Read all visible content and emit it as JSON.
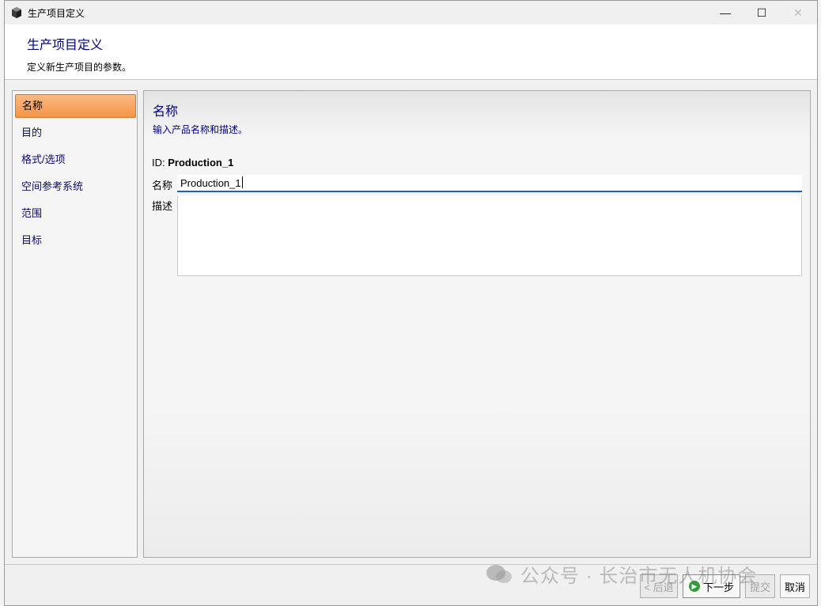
{
  "window": {
    "title": "生产项目定义",
    "controls": {
      "minimize": "—",
      "maximize": "☐",
      "close": "✕"
    }
  },
  "header": {
    "title": "生产项目定义",
    "subtitle": "定义新生产项目的参数。"
  },
  "nav": {
    "items": [
      {
        "label": "名称",
        "active": true
      },
      {
        "label": "目的",
        "active": false
      },
      {
        "label": "格式/选项",
        "active": false
      },
      {
        "label": "空间参考系统",
        "active": false
      },
      {
        "label": "范围",
        "active": false
      },
      {
        "label": "目标",
        "active": false
      }
    ]
  },
  "panel": {
    "title": "名称",
    "subtitle": "输入产品名称和描述。",
    "id_label": "ID:",
    "id_value": "Production_1",
    "name_label": "名称",
    "name_value": "Production_1",
    "desc_label": "描述",
    "desc_value": ""
  },
  "buttons": {
    "back": "< 后退",
    "next": "下一步",
    "submit": "提交",
    "cancel": "取消"
  },
  "watermark": {
    "text": "公众号 · 长治市无人机协会"
  },
  "colors": {
    "nav_active": "#f39549",
    "title_text": "#000080",
    "input_focus": "#1a63b8",
    "next_icon": "#2e9d3a"
  }
}
